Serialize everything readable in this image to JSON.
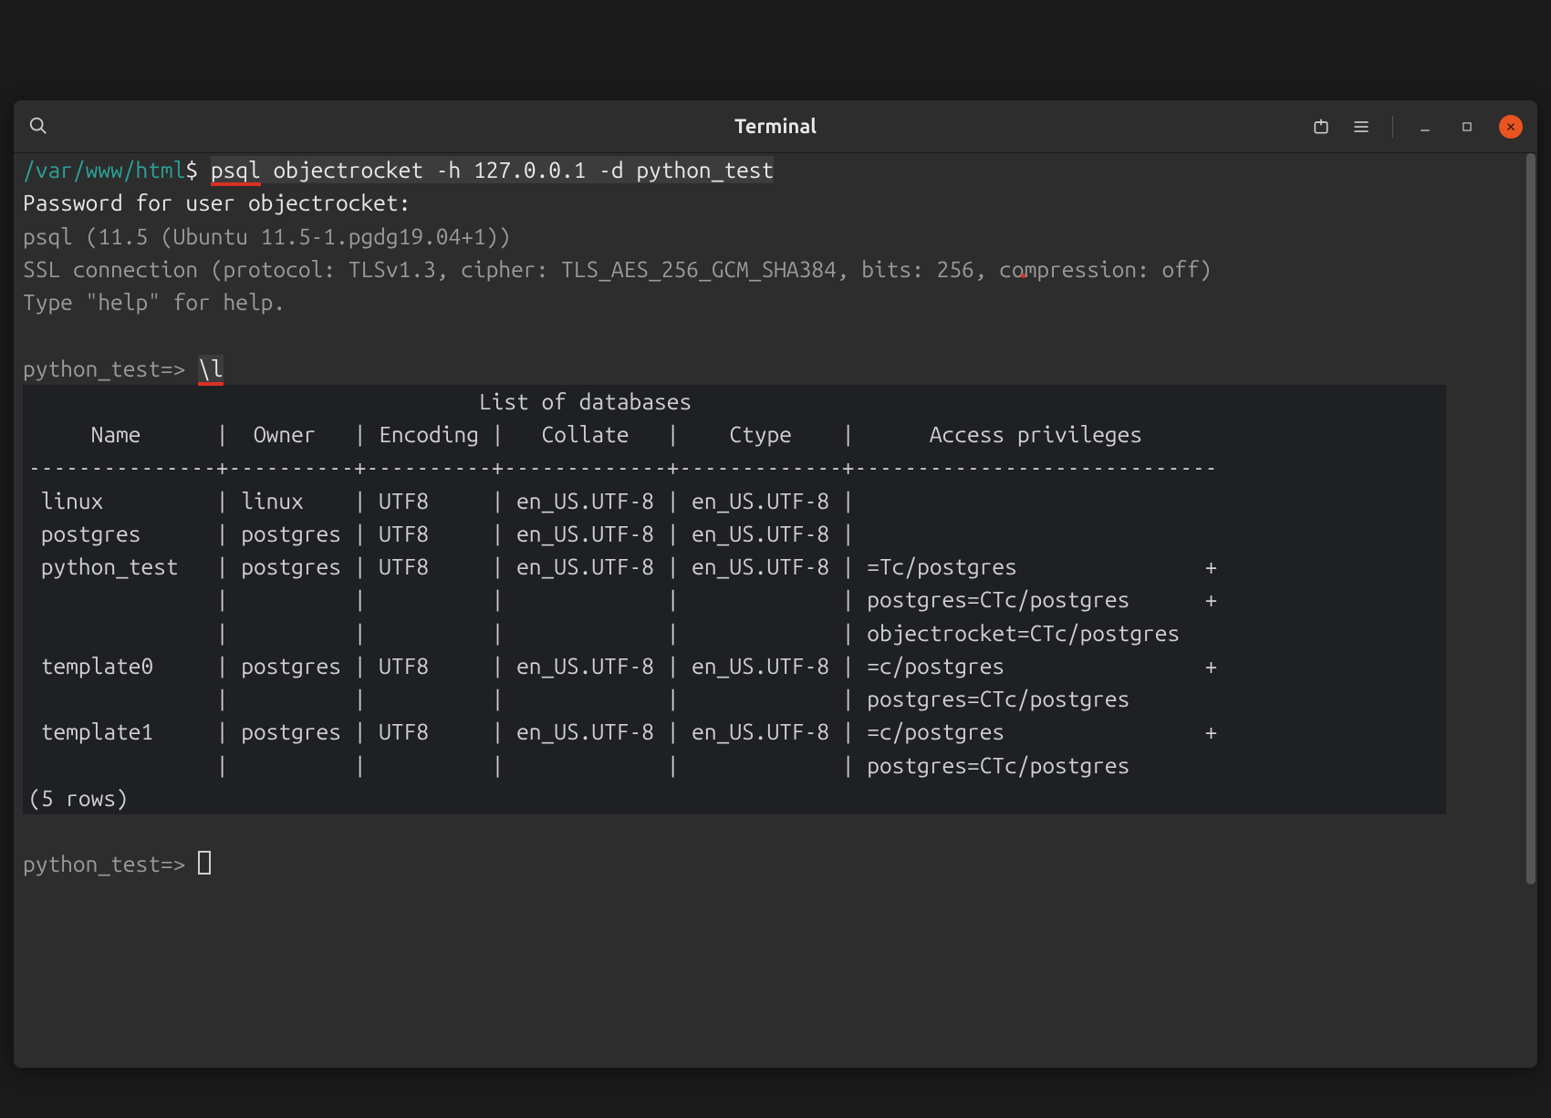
{
  "window": {
    "title": "Terminal"
  },
  "shell": {
    "cwd": "/var/www/html",
    "prompt_symbol": "$",
    "command_head": "psql",
    "command_rest": " objectrocket -h 127.0.0.1 -d python_test",
    "pwd_line": "Password for user objectrocket:",
    "version_line": "psql (11.5 (Ubuntu 11.5-1.pgdg19.04+1))",
    "ssl_line": "SSL connection (protocol: TLSv1.3, cipher: TLS_AES_256_GCM_SHA384, bits: 256, compression: off)",
    "help_line": "Type \"help\" for help."
  },
  "psql": {
    "prompt": "python_test=>",
    "meta_cmd": "\\l",
    "list_title": "List of databases",
    "headers": [
      "Name",
      "Owner",
      "Encoding",
      "Collate",
      "Ctype",
      "Access privileges"
    ],
    "sep_line": "---------------+----------+----------+-------------+-------------+-----------------------------",
    "rows": [
      [
        " linux         ",
        " linux    ",
        " UTF8     ",
        " en_US.UTF-8 ",
        " en_US.UTF-8 ",
        " "
      ],
      [
        " postgres      ",
        " postgres ",
        " UTF8     ",
        " en_US.UTF-8 ",
        " en_US.UTF-8 ",
        " "
      ],
      [
        " python_test   ",
        " postgres ",
        " UTF8     ",
        " en_US.UTF-8 ",
        " en_US.UTF-8 ",
        " =Tc/postgres               +"
      ],
      [
        "               ",
        "          ",
        "          ",
        "             ",
        "             ",
        " postgres=CTc/postgres      +"
      ],
      [
        "               ",
        "          ",
        "          ",
        "             ",
        "             ",
        " objectrocket=CTc/postgres"
      ],
      [
        " template0     ",
        " postgres ",
        " UTF8     ",
        " en_US.UTF-8 ",
        " en_US.UTF-8 ",
        " =c/postgres                +"
      ],
      [
        "               ",
        "          ",
        "          ",
        "             ",
        "             ",
        " postgres=CTc/postgres"
      ],
      [
        " template1     ",
        " postgres ",
        " UTF8     ",
        " en_US.UTF-8 ",
        " en_US.UTF-8 ",
        " =c/postgres                +"
      ],
      [
        "               ",
        "          ",
        "          ",
        "             ",
        "             ",
        " postgres=CTc/postgres"
      ]
    ],
    "row_count_line": "(5 rows)"
  }
}
